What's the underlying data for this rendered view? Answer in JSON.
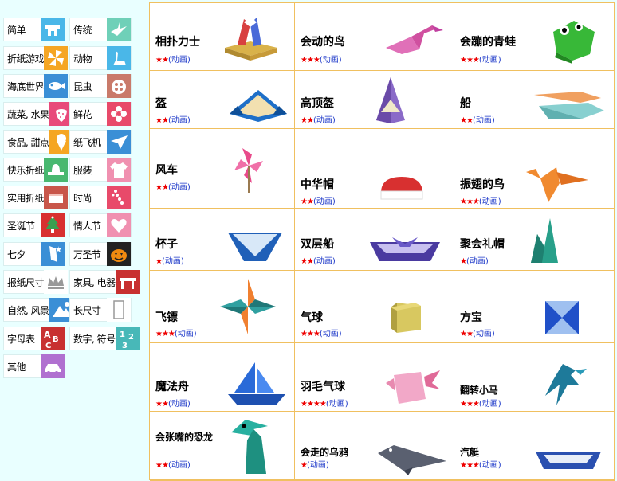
{
  "sidebar": {
    "categories": [
      {
        "label": "简单",
        "icon": "house-icon",
        "color": "#4ab7e8"
      },
      {
        "label": "传统",
        "icon": "crane-icon",
        "color": "#6fd0b8"
      },
      {
        "label": "折纸游戏",
        "icon": "pinwheel-icon",
        "color": "#f5a623"
      },
      {
        "label": "动物",
        "icon": "swan-icon",
        "color": "#4ab7e8"
      },
      {
        "label": "海底世界",
        "icon": "fish-icon",
        "color": "#3a8fd6"
      },
      {
        "label": "昆虫",
        "icon": "ladybug-icon",
        "color": "#c97a6a"
      },
      {
        "label": "蔬菜, 水果",
        "icon": "strawberry-icon",
        "color": "#e84a7a"
      },
      {
        "label": "鲜花",
        "icon": "flower-icon",
        "color": "#e84a6a"
      },
      {
        "label": "食品, 甜点",
        "icon": "icecream-icon",
        "color": "#f5a623"
      },
      {
        "label": "纸飞机",
        "icon": "paper-plane-icon",
        "color": "#3a8fd6"
      },
      {
        "label": "快乐折纸",
        "icon": "hat-icon",
        "color": "#48b870"
      },
      {
        "label": "服装",
        "icon": "shirt-icon",
        "color": "#f090b0"
      },
      {
        "label": "实用折纸",
        "icon": "wallet-icon",
        "color": "#c8564a"
      },
      {
        "label": "时尚",
        "icon": "necklace-icon",
        "color": "#e84a6a"
      },
      {
        "label": "圣诞节",
        "icon": "christmas-tree-icon",
        "color": "#d83030"
      },
      {
        "label": "情人节",
        "icon": "heart-icon",
        "color": "#f090b0"
      },
      {
        "label": "七夕",
        "icon": "star-festival-icon",
        "color": "#3a8fd6"
      },
      {
        "label": "万圣节",
        "icon": "pumpkin-icon",
        "color": "#222222"
      },
      {
        "label": "报纸尺寸",
        "icon": "crown-icon",
        "color": "#888888"
      },
      {
        "label": "家具, 电器",
        "icon": "table-icon",
        "color": "#c83030"
      },
      {
        "label": "自然, 风景",
        "icon": "mountain-icon",
        "color": "#3a8fd6"
      },
      {
        "label": "长尺寸",
        "icon": "rectangle-icon",
        "color": "#888888"
      },
      {
        "label": "字母表",
        "icon": "abc-icon",
        "color": "#c83030"
      },
      {
        "label": "数字, 符号",
        "icon": "numbers-icon",
        "color": "#48b8b8"
      },
      {
        "label": "其他",
        "icon": "car-icon",
        "color": "#b070d0"
      }
    ]
  },
  "grid": {
    "anim_label": "(动画)",
    "items": [
      {
        "name": "相扑力士",
        "stars": "★★",
        "icon": "sumo-icon"
      },
      {
        "name": "会动的鸟",
        "stars": "★★★",
        "icon": "moving-bird-icon"
      },
      {
        "name": "会蹦的青蛙",
        "stars": "★★★",
        "icon": "jumping-frog-icon"
      },
      {
        "name": "盔",
        "stars": "★★",
        "icon": "helmet-icon"
      },
      {
        "name": "高顶盔",
        "stars": "★★",
        "icon": "tall-helmet-icon"
      },
      {
        "name": "船",
        "stars": "★★",
        "icon": "boat-icon"
      },
      {
        "name": "风车",
        "stars": "★★",
        "icon": "windmill-icon"
      },
      {
        "name": "中华帽",
        "stars": "★★",
        "icon": "chinese-hat-icon"
      },
      {
        "name": "振翅的鸟",
        "stars": "★★★",
        "icon": "flapping-bird-icon"
      },
      {
        "name": "杯子",
        "stars": "★",
        "icon": "cup-icon"
      },
      {
        "name": "双层船",
        "stars": "★★",
        "icon": "double-boat-icon"
      },
      {
        "name": "聚会礼帽",
        "stars": "★",
        "icon": "party-hat-icon"
      },
      {
        "name": "飞镖",
        "stars": "★★★",
        "icon": "shuriken-icon"
      },
      {
        "name": "气球",
        "stars": "★★★",
        "icon": "balloon-icon"
      },
      {
        "name": "方宝",
        "stars": "★★",
        "icon": "square-treasure-icon"
      },
      {
        "name": "魔法舟",
        "stars": "★★",
        "icon": "magic-boat-icon"
      },
      {
        "name": "羽毛气球",
        "stars": "★★★★",
        "icon": "feather-balloon-icon"
      },
      {
        "name": "翻转小马",
        "stars": "★★★",
        "icon": "flipping-horse-icon"
      },
      {
        "name": "会张嘴的恐龙",
        "stars": "★★",
        "icon": "dinosaur-icon"
      },
      {
        "name": "会走的乌鸦",
        "stars": "★",
        "icon": "walking-crow-icon"
      },
      {
        "name": "汽艇",
        "stars": "★★★",
        "icon": "motorboat-icon"
      }
    ]
  }
}
